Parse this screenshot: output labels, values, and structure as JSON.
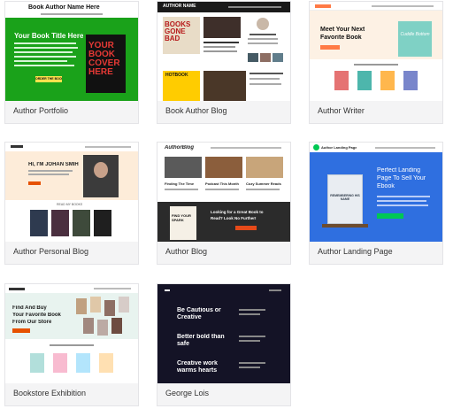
{
  "cards": [
    {
      "label": "Author Portfolio",
      "header_title": "Book Author Name Here",
      "heading": "Your Book Title Here",
      "button": "ORDER THE BOOK",
      "cover_lines": [
        "YOUR",
        "BOOK",
        "COVER",
        "HERE"
      ],
      "colors": {
        "bg": "#1aa21a",
        "cover": "#111111",
        "cover_text": "#e53935"
      }
    },
    {
      "label": "Book Author Blog",
      "logo": "AUTHOR NAME",
      "book_title": "BOOKS GONE BAD",
      "hotbook": "HOTBOOK"
    },
    {
      "label": "Author Writer",
      "heading_line1": "Meet Your Next",
      "heading_line2": "Favorite Book",
      "book_title": "Cuddle Bottom"
    },
    {
      "label": "Author Personal Blog",
      "heading": "HI, I'M JOHAN SMIH",
      "section": "READ MY BOOKS"
    },
    {
      "label": "Author Blog",
      "logo": "AuthorBlog",
      "posts": [
        "Finding The Time",
        "Podcast This Month",
        "Cozy Summer Reads"
      ],
      "promo_line1": "Looking for a Great Book to",
      "promo_line2": "Read? Look No Further!",
      "promo_book": "FIND YOUR SPARK"
    },
    {
      "label": "Author Landing Page",
      "logo": "Author Landing Page",
      "heading_line1": "Perfect Landing",
      "heading_line2": "Page To Sell Your",
      "heading_line3": "Ebook",
      "book_title": "REMEMBERING HIS NAME"
    },
    {
      "label": "Bookstore Exhibition",
      "heading_line1": "Find And Buy",
      "heading_line2": "Your Favorite Book",
      "heading_line3": "From Our Store"
    },
    {
      "label": "George Lois",
      "lines": [
        "Be Cautious or Creative",
        "Better bold than safe",
        "Creative work warms hearts"
      ]
    }
  ]
}
